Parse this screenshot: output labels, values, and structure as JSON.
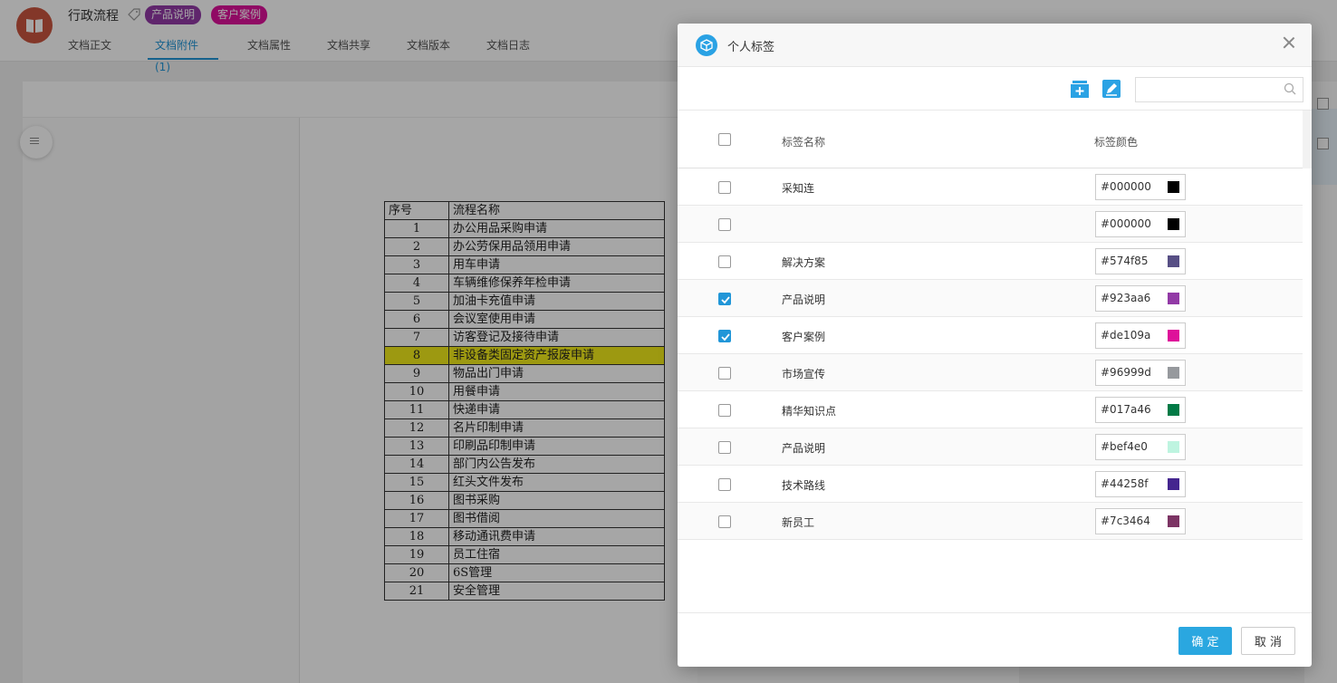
{
  "app": {
    "doc_title": "行政流程",
    "tags": [
      {
        "label": "产品说明",
        "color": "#923aa6"
      },
      {
        "label": "客户案例",
        "color": "#de109a"
      }
    ],
    "tabs": [
      "文档正文",
      "文档附件(1)",
      "文档属性",
      "文档共享",
      "文档版本",
      "文档日志"
    ],
    "active_tab": "文档附件(1)"
  },
  "sheet": {
    "header": [
      "序号",
      "流程名称"
    ],
    "rows": [
      [
        "1",
        "办公用品采购申请"
      ],
      [
        "2",
        "办公劳保用品领用申请"
      ],
      [
        "3",
        "用车申请"
      ],
      [
        "4",
        "车辆维修保养年检申请"
      ],
      [
        "5",
        "加油卡充值申请"
      ],
      [
        "6",
        "会议室使用申请"
      ],
      [
        "7",
        "访客登记及接待申请"
      ],
      [
        "8",
        "非设备类固定资产报废申请"
      ],
      [
        "9",
        "物品出门申请"
      ],
      [
        "10",
        "用餐申请"
      ],
      [
        "11",
        "快递申请"
      ],
      [
        "12",
        "名片印制申请"
      ],
      [
        "13",
        "印刷品印制申请"
      ],
      [
        "14",
        "部门内公告发布"
      ],
      [
        "15",
        "红头文件发布"
      ],
      [
        "16",
        "图书采购"
      ],
      [
        "17",
        "图书借阅"
      ],
      [
        "18",
        "移动通讯费申请"
      ],
      [
        "19",
        "员工住宿"
      ],
      [
        "20",
        "6S管理"
      ],
      [
        "21",
        "安全管理"
      ]
    ],
    "highlight_color": "#f2eb1b"
  },
  "modal": {
    "title": "个人标签",
    "search_placeholder": "",
    "columns": {
      "name": "标签名称",
      "color": "标签颜色"
    },
    "rows": [
      {
        "name": "采知连",
        "hex": "#000000",
        "checked": false
      },
      {
        "name": "",
        "hex": "#000000",
        "checked": false
      },
      {
        "name": "解决方案",
        "hex": "#574f85",
        "checked": false
      },
      {
        "name": "产品说明",
        "hex": "#923aa6",
        "checked": true
      },
      {
        "name": "客户案例",
        "hex": "#de109a",
        "checked": true
      },
      {
        "name": "市场宣传",
        "hex": "#96999d",
        "checked": false
      },
      {
        "name": "精华知识点",
        "hex": "#017a46",
        "checked": false
      },
      {
        "name": "产品说明",
        "hex": "#bef4e0",
        "checked": false
      },
      {
        "name": "技术路线",
        "hex": "#44258f",
        "checked": false
      },
      {
        "name": "新员工",
        "hex": "#7c3464",
        "checked": false
      }
    ],
    "ok_label": "确 定",
    "cancel_label": "取 消",
    "accent": "#2aa7e0"
  }
}
